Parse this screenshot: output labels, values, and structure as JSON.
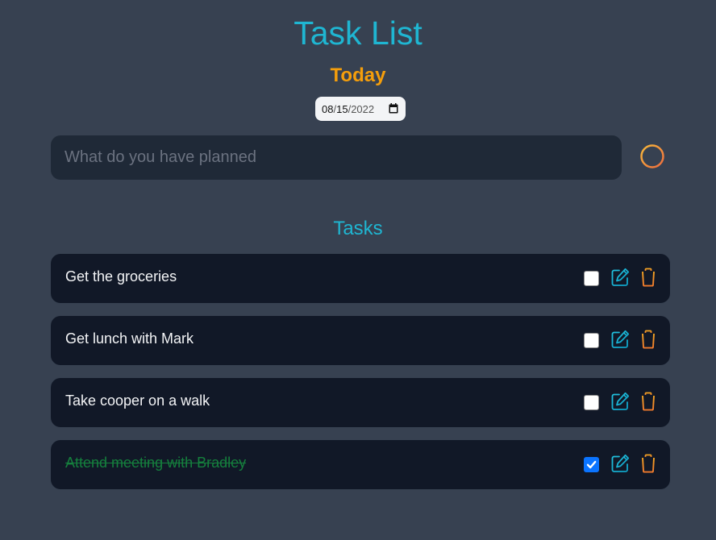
{
  "header": {
    "title": "Task List",
    "day_label": "Today"
  },
  "date_picker": {
    "month": "08",
    "day": "15",
    "year": "2022"
  },
  "new_task": {
    "placeholder": "What do you have planned",
    "value": ""
  },
  "tasks_section": {
    "heading": "Tasks",
    "items": [
      {
        "text": "Get the groceries",
        "completed": false
      },
      {
        "text": "Get lunch with Mark",
        "completed": false
      },
      {
        "text": "Take cooper on a walk",
        "completed": false
      },
      {
        "text": "Attend meeting with Bradley",
        "completed": true
      }
    ]
  },
  "icons": {
    "add": "plus-circle-icon",
    "edit": "pencil-square-icon",
    "delete": "trash-icon",
    "calendar": "calendar-icon"
  },
  "colors": {
    "background": "#374151",
    "title": "#1fb6d2",
    "accent": "#f59e0b",
    "input_bg": "#1f2937",
    "task_bg": "#111827",
    "completed_text": "#15803d",
    "checkbox_checked": "#0b74ff"
  }
}
